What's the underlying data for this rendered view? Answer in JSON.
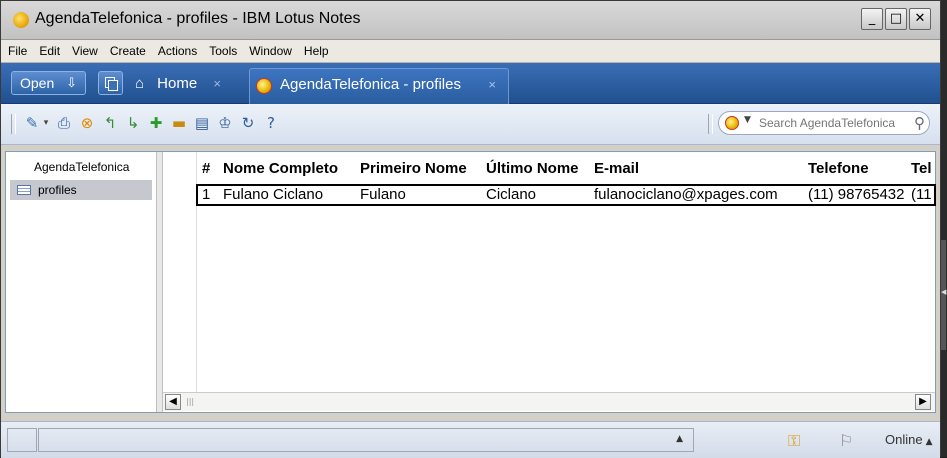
{
  "window": {
    "title": "AgendaTelefonica - profiles - IBM Lotus Notes",
    "min": "_",
    "max": "□",
    "close": "✕"
  },
  "menu": [
    "File",
    "Edit",
    "View",
    "Create",
    "Actions",
    "Tools",
    "Window",
    "Help"
  ],
  "tabs": {
    "open_label": "Open",
    "home_label": "Home",
    "active_label": "AgendaTelefonica - profiles",
    "close_glyph": "×"
  },
  "search": {
    "placeholder": "Search AgendaTelefonica"
  },
  "nav": {
    "title": "AgendaTelefonica",
    "items": [
      "profiles"
    ]
  },
  "view": {
    "columns": [
      "#",
      "Nome Completo",
      "Primeiro Nome",
      "Último Nome",
      "E-mail",
      "Telefone",
      "Tel"
    ],
    "rows": [
      [
        "1",
        "Fulano Ciclano",
        "Fulano",
        "Ciclano",
        "fulanociclano@xpages.com",
        "(11) 98765432",
        "(11"
      ]
    ]
  },
  "status": {
    "online_label": "Online"
  },
  "colors": {
    "tabbar": "#2a5da0",
    "toolbar": "#dfe7f2",
    "selection_border": "#000000"
  }
}
